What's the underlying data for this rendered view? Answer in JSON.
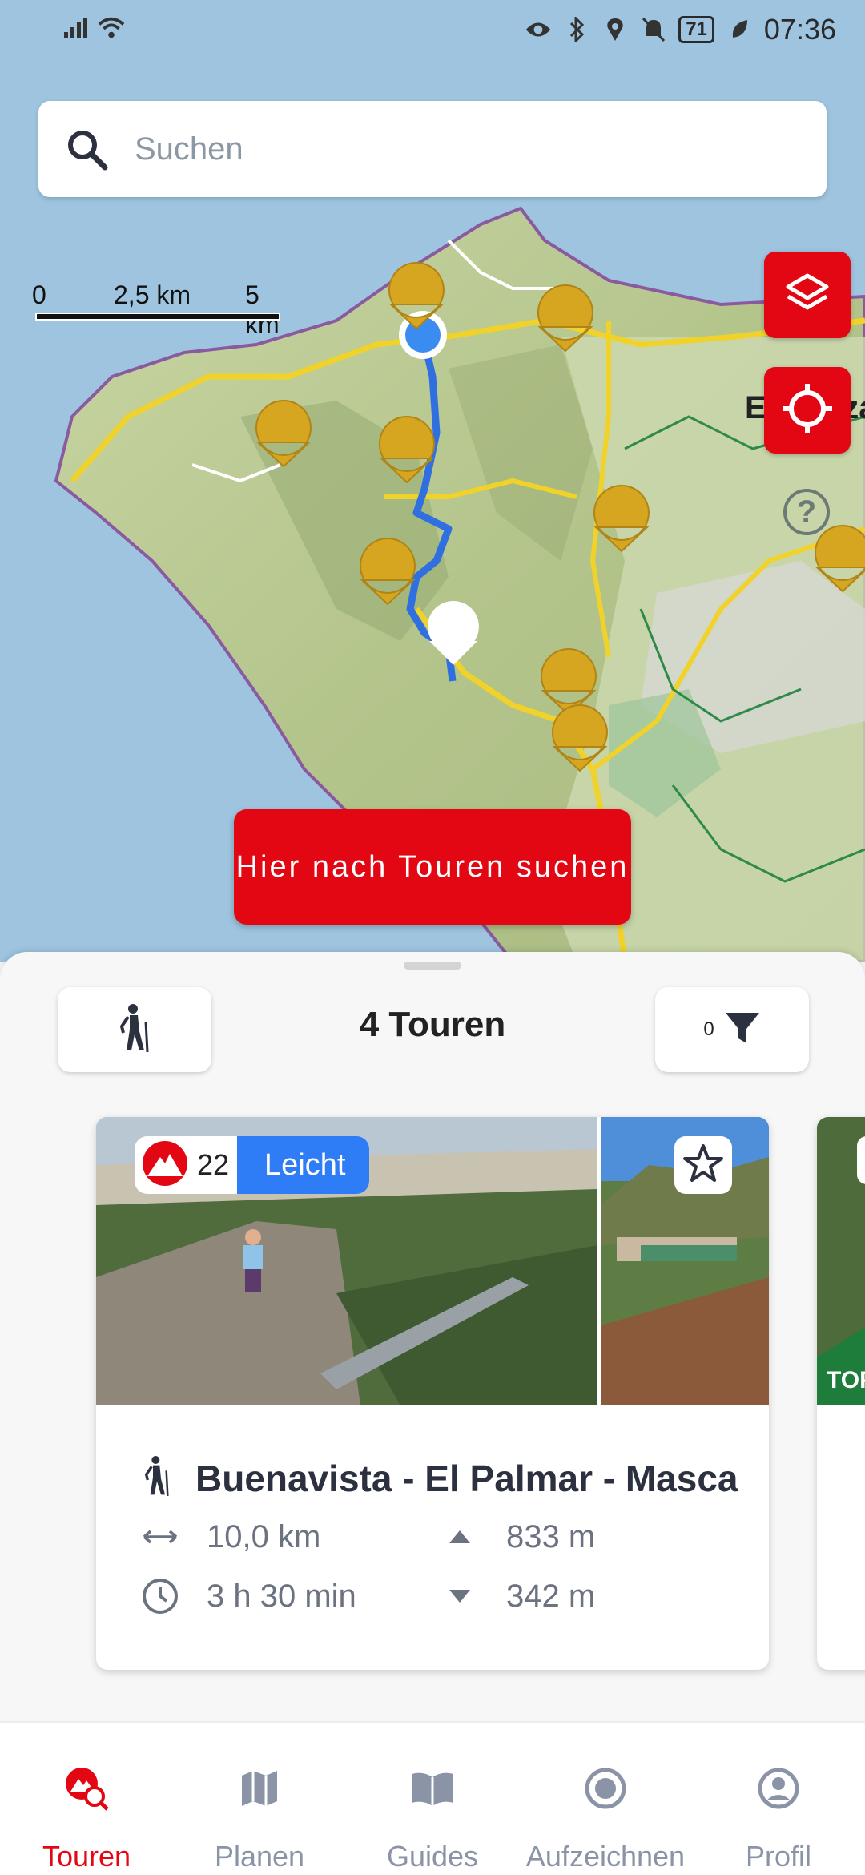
{
  "status_bar": {
    "time": "07:36",
    "battery": "71",
    "icons": [
      "signal-icon",
      "wifi-icon",
      "eye-icon",
      "bluetooth-icon",
      "location-icon",
      "mute-bell-icon",
      "battery-icon",
      "leaf-icon"
    ]
  },
  "search": {
    "placeholder": "Suchen"
  },
  "map": {
    "scale": {
      "labels": [
        "0",
        "2,5 km",
        "5 km"
      ]
    },
    "place_label": "El Sauzal",
    "search_here_label": "Hier nach Touren suchen",
    "accent_color": "#e30613"
  },
  "sheet": {
    "tour_count": "4 Touren",
    "filter_count": "0"
  },
  "tour_card": {
    "score": "22",
    "difficulty": "Leicht",
    "title": "Buenavista - El Palmar - Masca",
    "distance": "10,0 km",
    "duration": "3 h 30 min",
    "ascent": "833 m",
    "descent": "342 m",
    "difficulty_color": "#2f7df6"
  },
  "next_card_peek": {
    "label": "TOP"
  },
  "bottom_nav": {
    "items": [
      {
        "label": "Touren",
        "icon": "tour-search-icon",
        "active": true
      },
      {
        "label": "Planen",
        "icon": "map-icon",
        "active": false
      },
      {
        "label": "Guides",
        "icon": "book-icon",
        "active": false
      },
      {
        "label": "Aufzeichnen",
        "icon": "record-icon",
        "active": false
      },
      {
        "label": "Profil",
        "icon": "profile-icon",
        "active": false
      }
    ]
  }
}
